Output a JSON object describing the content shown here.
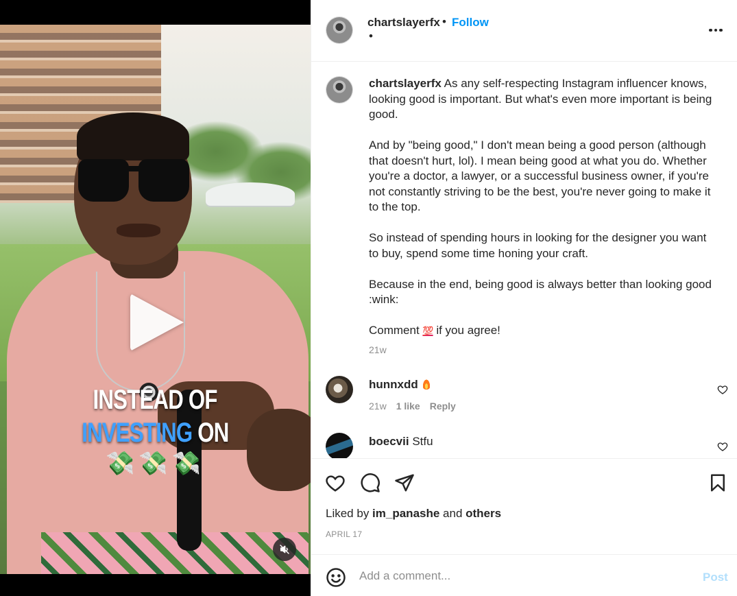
{
  "video": {
    "overlay_line1": "INSTEAD OF",
    "overlay_line2_blue": "INVESTING",
    "overlay_line2_white": " ON",
    "overlay_line3": "💸💸💸",
    "play_icon": "play-icon",
    "mute_icon": "audio-muted-icon"
  },
  "header": {
    "username": "chartslayerfx",
    "separator": "•",
    "follow_label": "Follow",
    "subline": "•",
    "more_icon": "more-options-icon"
  },
  "caption": {
    "username": "chartslayerfx",
    "paragraphs": [
      "As any self-respecting Instagram influencer knows, looking good is important. But what's even more important is being good.",
      "And by \"being good,\" I don't mean being a good person (although that doesn't hurt, lol). I mean being good at what you do. Whether you're a doctor, a lawyer, or a successful business owner, if you're not constantly striving to be the best, you're never going to make it to the top.",
      "So instead of spending hours in looking for the designer you want to buy, spend some time honing your craft.",
      "Because in the end, being good is always better than looking good :wink:"
    ],
    "cta_before": "Comment ",
    "cta_emoji": "💯",
    "cta_after": " if you agree!",
    "time": "21w"
  },
  "comments": [
    {
      "username": "hunnxdd",
      "text": "",
      "emoji": "fire-emoji",
      "time": "21w",
      "likes": "1 like",
      "reply_label": "Reply"
    },
    {
      "username": "boecvii",
      "text": " Stfu"
    }
  ],
  "actions": {
    "like_icon": "heart-icon",
    "comment_icon": "comment-icon",
    "share_icon": "share-icon",
    "save_icon": "bookmark-icon",
    "liked_by_prefix": "Liked by ",
    "liked_by_user": "im_panashe",
    "liked_by_middle": " and ",
    "liked_by_others": "others",
    "date": "APRIL 17"
  },
  "add_comment": {
    "placeholder": "Add a comment...",
    "post_label": "Post",
    "emoji_icon": "emoji-smiley-icon"
  },
  "colors": {
    "accent": "#0095f6",
    "post_disabled": "#b2dffc",
    "text": "#262626",
    "muted": "#8e8e8e",
    "overlay_blue": "#3fa0ff"
  }
}
